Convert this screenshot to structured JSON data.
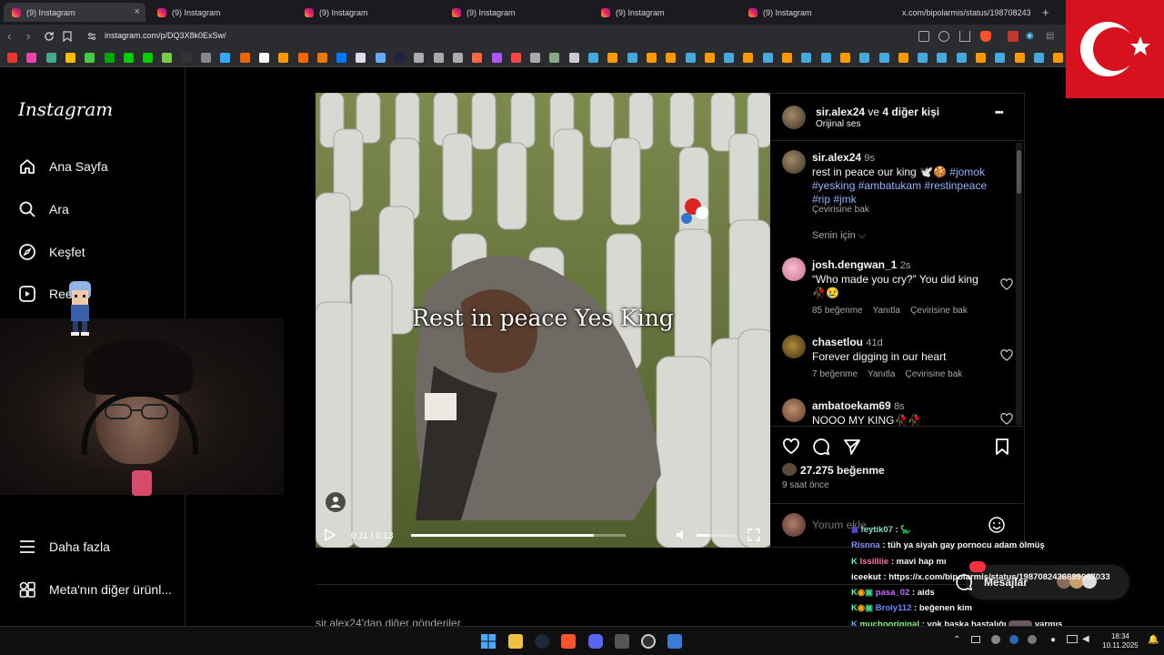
{
  "browser": {
    "tabs": [
      {
        "title": "(9) Instagram"
      },
      {
        "title": "(9) Instagram"
      },
      {
        "title": "(9) Instagram"
      },
      {
        "title": "(9) Instagram"
      },
      {
        "title": "(9) Instagram"
      },
      {
        "title": "(9) Instagram"
      },
      {
        "title": "x.com/bipolarmis/status/198708243"
      }
    ],
    "close_glyph": "×",
    "new_tab_glyph": "+",
    "url": "instagram.com/p/DQ3X8k0ExSw/"
  },
  "sidebar": {
    "logo": "Instagram",
    "items": [
      {
        "label": "Ana Sayfa",
        "icon": "home-icon"
      },
      {
        "label": "Ara",
        "icon": "search-icon"
      },
      {
        "label": "Keşfet",
        "icon": "compass-icon"
      },
      {
        "label": "Ree",
        "icon": "reels-icon"
      }
    ],
    "bottom_items": [
      {
        "label": "Daha fazla",
        "icon": "menu-icon"
      },
      {
        "label": "Meta'nın diğer ürünl...",
        "icon": "meta-apps-icon"
      }
    ]
  },
  "post": {
    "overlay_caption": "Rest in peace Yes King",
    "time_display": "0:11 / 0:13",
    "progress": 0.85,
    "header": {
      "username": "sir.alex24",
      "suffix": " ve ",
      "others": "4 diğer kişi",
      "audio": "Orijinal ses",
      "more": "•••"
    },
    "caption": {
      "username": "sir.alex24",
      "time": "9s",
      "text": "rest in peace our king 🕊️🍪",
      "hashtags_line1": "#jomok",
      "hashtags_line2": "#yesking #ambatukam #restinpeace",
      "hashtags_line3": "#rip #jmk",
      "translate": "Çevirisine bak"
    },
    "sort_label": "Senin için",
    "comments": [
      {
        "username": "josh.dengwan_1",
        "time": "2s",
        "text_line1": "“Who made you cry?” You did king",
        "text_line2": "🥀😢",
        "likes": "85 beğenme",
        "reply": "Yanıtla",
        "translate": "Çevirisine bak"
      },
      {
        "username": "chasetlou",
        "time": "41d",
        "text_line1": "Forever digging in our heart",
        "likes": "7 beğenme",
        "reply": "Yanıtla",
        "translate": "Çevirisine bak"
      },
      {
        "username": "ambatoekam69",
        "time": "8s",
        "text_line1": "NOOO MY KING🥀🥀"
      }
    ],
    "like_count": "27.275 beğenme",
    "posted_ago": "9 saat önce",
    "comment_placeholder": "Yorum ekle...",
    "more_posts": "sir.alex24'dan diğer gönderiler"
  },
  "chat": {
    "lines": [
      {
        "user": "feytik07",
        "sep": " : ",
        "msg": "",
        "color": "#7fe0c0"
      },
      {
        "user": "Risnna",
        "sep": " : ",
        "msg": "tüh ya siyah gay pornocu adam ölmüş",
        "color": "#8a8cff"
      },
      {
        "user": "Issilliie",
        "sep": " : ",
        "msg": "mavi hap mı",
        "color": "#ff6fb0"
      },
      {
        "user": "iceekut",
        "sep": " : ",
        "msg": "https://x.com/bipolarmis/status/1987082436899967033",
        "color": "#ffffff"
      },
      {
        "user": "pasa_02",
        "sep": " : ",
        "msg": "aids",
        "color": "#c86bff"
      },
      {
        "user": "Broly112",
        "sep": " : ",
        "msg": "beğenen kim",
        "color": "#6b8cff"
      },
      {
        "user": "muchooriginal",
        "sep": " : ",
        "msg": "yok başka hastalığı",
        "msg2": "varmış",
        "color": "#7dff7d"
      }
    ],
    "messages_label": "Mesajlar"
  },
  "taskbar": {
    "time": "18:34",
    "date": "10.11.2025"
  },
  "colors": {
    "flag_red": "#d8111e",
    "link_blue": "#8ab4ff"
  }
}
